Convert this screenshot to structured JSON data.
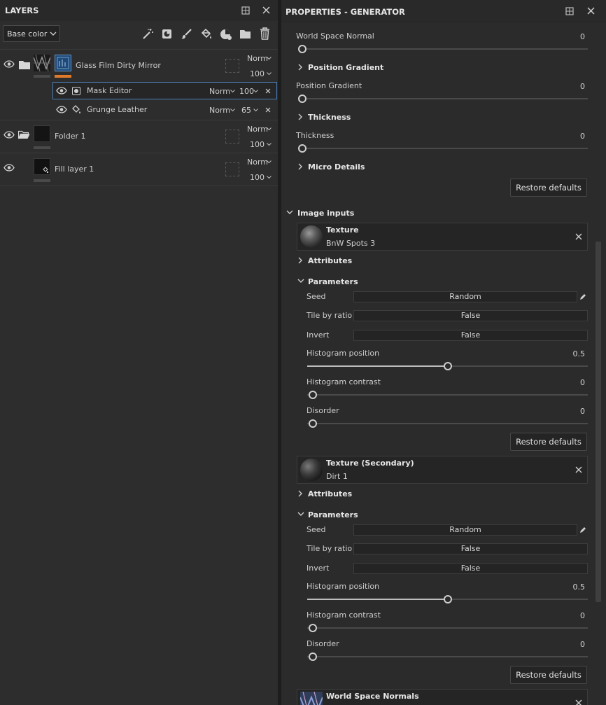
{
  "layers_panel": {
    "title": "LAYERS",
    "channel_select": "Base color",
    "layers": [
      {
        "name": "Glass Film Dirty Mirror",
        "blend": "Norm",
        "opacity": "100"
      },
      {
        "name": "Mask Editor",
        "blend": "Norm",
        "opacity": "100"
      },
      {
        "name": "Grunge Leather",
        "blend": "Norm",
        "opacity": "65"
      },
      {
        "name": "Folder 1",
        "blend": "Norm",
        "opacity": "100"
      },
      {
        "name": "Fill layer 1",
        "blend": "Norm",
        "opacity": "100"
      }
    ]
  },
  "properties_panel": {
    "title": "PROPERTIES - GENERATOR",
    "world_space_normal": {
      "label": "World Space Normal",
      "value": "0"
    },
    "position_gradient_section": "Position Gradient",
    "position_gradient": {
      "label": "Position Gradient",
      "value": "0"
    },
    "thickness_section": "Thickness",
    "thickness": {
      "label": "Thickness",
      "value": "0"
    },
    "micro_details_section": "Micro Details",
    "restore_defaults": "Restore defaults",
    "image_inputs_section": "Image inputs",
    "textures": [
      {
        "title": "Texture",
        "name": "BnW Spots 3",
        "attributes": "Attributes",
        "parameters": "Parameters",
        "seed_label": "Seed",
        "seed_value": "Random",
        "tile_label": "Tile by ratio",
        "tile_value": "False",
        "invert_label": "Invert",
        "invert_value": "False",
        "hist_pos_label": "Histogram position",
        "hist_pos_value": "0.5",
        "hist_con_label": "Histogram contrast",
        "hist_con_value": "0",
        "disorder_label": "Disorder",
        "disorder_value": "0",
        "restore": "Restore defaults"
      },
      {
        "title": "Texture (Secondary)",
        "name": "Dirt 1",
        "attributes": "Attributes",
        "parameters": "Parameters",
        "seed_label": "Seed",
        "seed_value": "Random",
        "tile_label": "Tile by ratio",
        "tile_value": "False",
        "invert_label": "Invert",
        "invert_value": "False",
        "hist_pos_label": "Histogram position",
        "hist_pos_value": "0.5",
        "hist_con_label": "Histogram contrast",
        "hist_con_value": "0",
        "disorder_label": "Disorder",
        "disorder_value": "0",
        "restore": "Restore defaults"
      }
    ],
    "world_space_normals_card": "World Space Normals"
  },
  "colors": {
    "accent_orange": "#e07a2a",
    "selection_blue": "#4a7fb5"
  },
  "icons": [
    "eye-icon",
    "folder-icon",
    "magic-wand-icon",
    "smart-mask-icon",
    "brush-icon",
    "fill-bucket-icon",
    "effects-icon",
    "add-folder-icon",
    "trash-icon",
    "close-icon",
    "pin-icon",
    "chevron-right-icon",
    "chevron-down-icon",
    "pencil-icon"
  ]
}
